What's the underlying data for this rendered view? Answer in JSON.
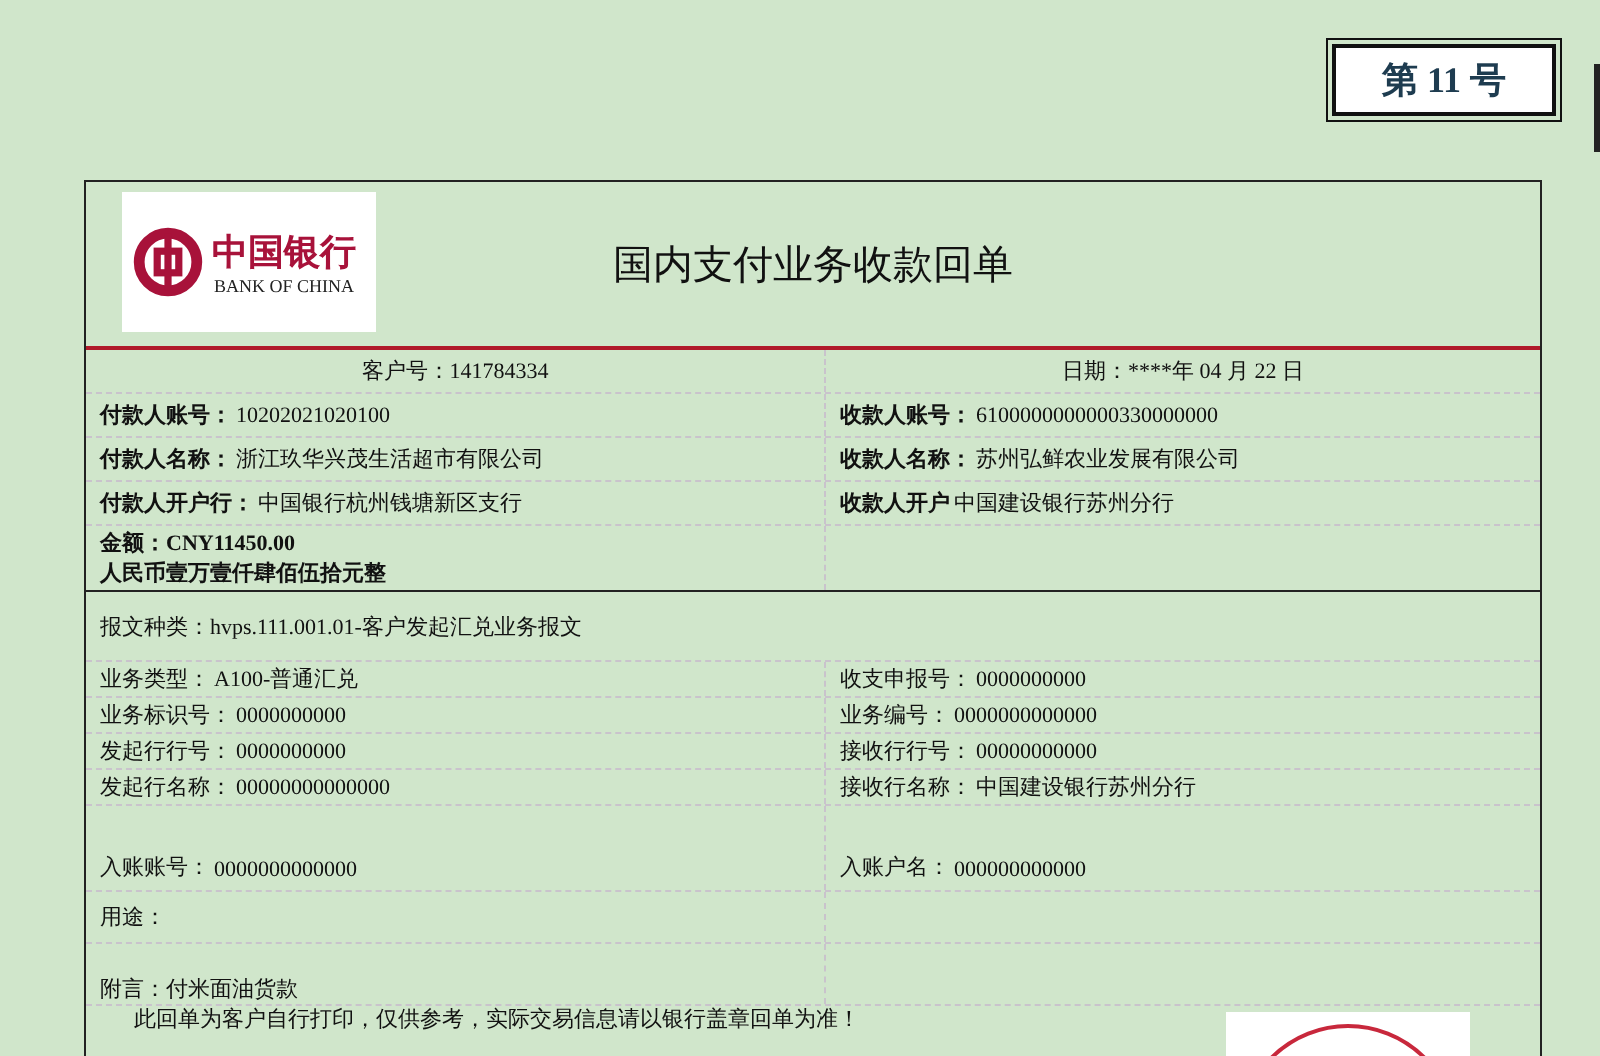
{
  "badge": "第 11 号",
  "logo": {
    "name_cn": "中国银行",
    "name_en": "BANK OF CHINA"
  },
  "title": "国内支付业务收款回单",
  "header_row": {
    "left": "客户号：141784334",
    "right": "日期：****年 04 月 22 日"
  },
  "party_rows": [
    {
      "left": {
        "label": "付款人账号：",
        "value": "10202021020100"
      },
      "right": {
        "label": "收款人账号：",
        "value": "6100000000000330000000"
      }
    },
    {
      "left": {
        "label": "付款人名称：",
        "value": "浙江玖华兴茂生活超市有限公司"
      },
      "right": {
        "label": "收款人名称：",
        "value": "苏州弘鲜农业发展有限公司"
      }
    },
    {
      "left": {
        "label": "付款人开户行：",
        "value": "中国银行杭州钱塘新区支行"
      },
      "right": {
        "label": "收款人开户",
        "value": "中国建设银行苏州分行"
      }
    }
  ],
  "amount": "金额：CNY11450.00",
  "amount_words": "人民币壹万壹仟肆佰伍拾元整",
  "message_type": "报文种类：hvps.111.001.01-客户发起汇兑业务报文",
  "detail_rows": [
    {
      "left": {
        "label": "业务类型：",
        "value": "A100-普通汇兑"
      },
      "right": {
        "label": "收支申报号：",
        "value": "0000000000"
      }
    },
    {
      "left": {
        "label": "业务标识号：",
        "value": "0000000000"
      },
      "right": {
        "label": "业务编号：",
        "value": "0000000000000"
      }
    },
    {
      "left": {
        "label": "发起行行号：",
        "value": "0000000000"
      },
      "right": {
        "label": "接收行行号：",
        "value": "00000000000"
      }
    },
    {
      "left": {
        "label": "发起行名称：",
        "value": "00000000000000"
      },
      "right": {
        "label": "接收行名称：",
        "value": "中国建设银行苏州分行"
      }
    }
  ],
  "account_row": {
    "left": {
      "label": "入账账号：",
      "value": "0000000000000"
    },
    "right": {
      "label": "入账户名：",
      "value": "000000000000"
    }
  },
  "purpose": "用途：",
  "remark": "附言：付米面油货款",
  "notice": "此回单为客户自行打印，仅供参考，实际交易信息请以银行盖章回单为准！"
}
